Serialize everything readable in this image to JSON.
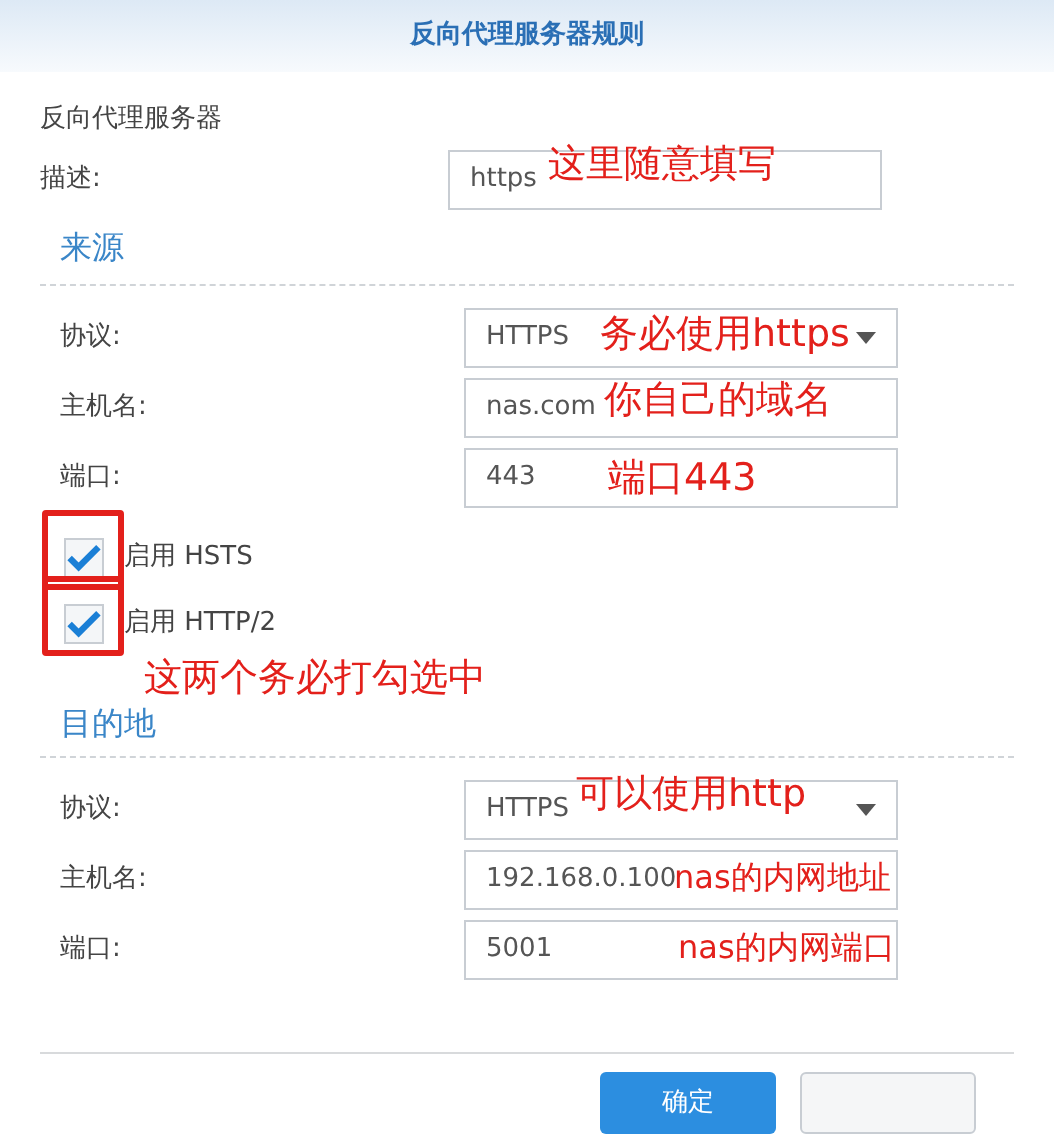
{
  "window": {
    "title": "反向代理服务器规则"
  },
  "section_title": "反向代理服务器",
  "description": {
    "label": "描述:",
    "value": "https",
    "note": "这里随意填写"
  },
  "source": {
    "title": "来源",
    "fields": [
      {
        "kind": "dropdown",
        "label": "协议:",
        "value": "HTTPS",
        "note": "务必使用https"
      },
      {
        "kind": "text",
        "label": "主机名:",
        "value": "nas.com",
        "note": "你自己的域名"
      },
      {
        "kind": "text",
        "label": "端口:",
        "value": "443",
        "note": "端口443"
      }
    ],
    "options": [
      {
        "label": "启用 HSTS",
        "checked": true,
        "highlighted": true
      },
      {
        "label": "启用 HTTP/2",
        "checked": true,
        "highlighted": true
      }
    ],
    "options_note": "这两个务必打勾选中"
  },
  "destination": {
    "title": "目的地",
    "fields": [
      {
        "kind": "dropdown",
        "label": "协议:",
        "value": "HTTPS",
        "note": "可以使用http"
      },
      {
        "kind": "text",
        "label": "主机名:",
        "value": "192.168.0.100",
        "note": "nas的内网地址"
      },
      {
        "kind": "text",
        "label": "端口:",
        "value": "5001",
        "note": "nas的内网端口"
      }
    ]
  },
  "buttons": [
    {
      "kind": "primary",
      "label": "确定"
    },
    {
      "kind": "secondary"
    }
  ]
}
